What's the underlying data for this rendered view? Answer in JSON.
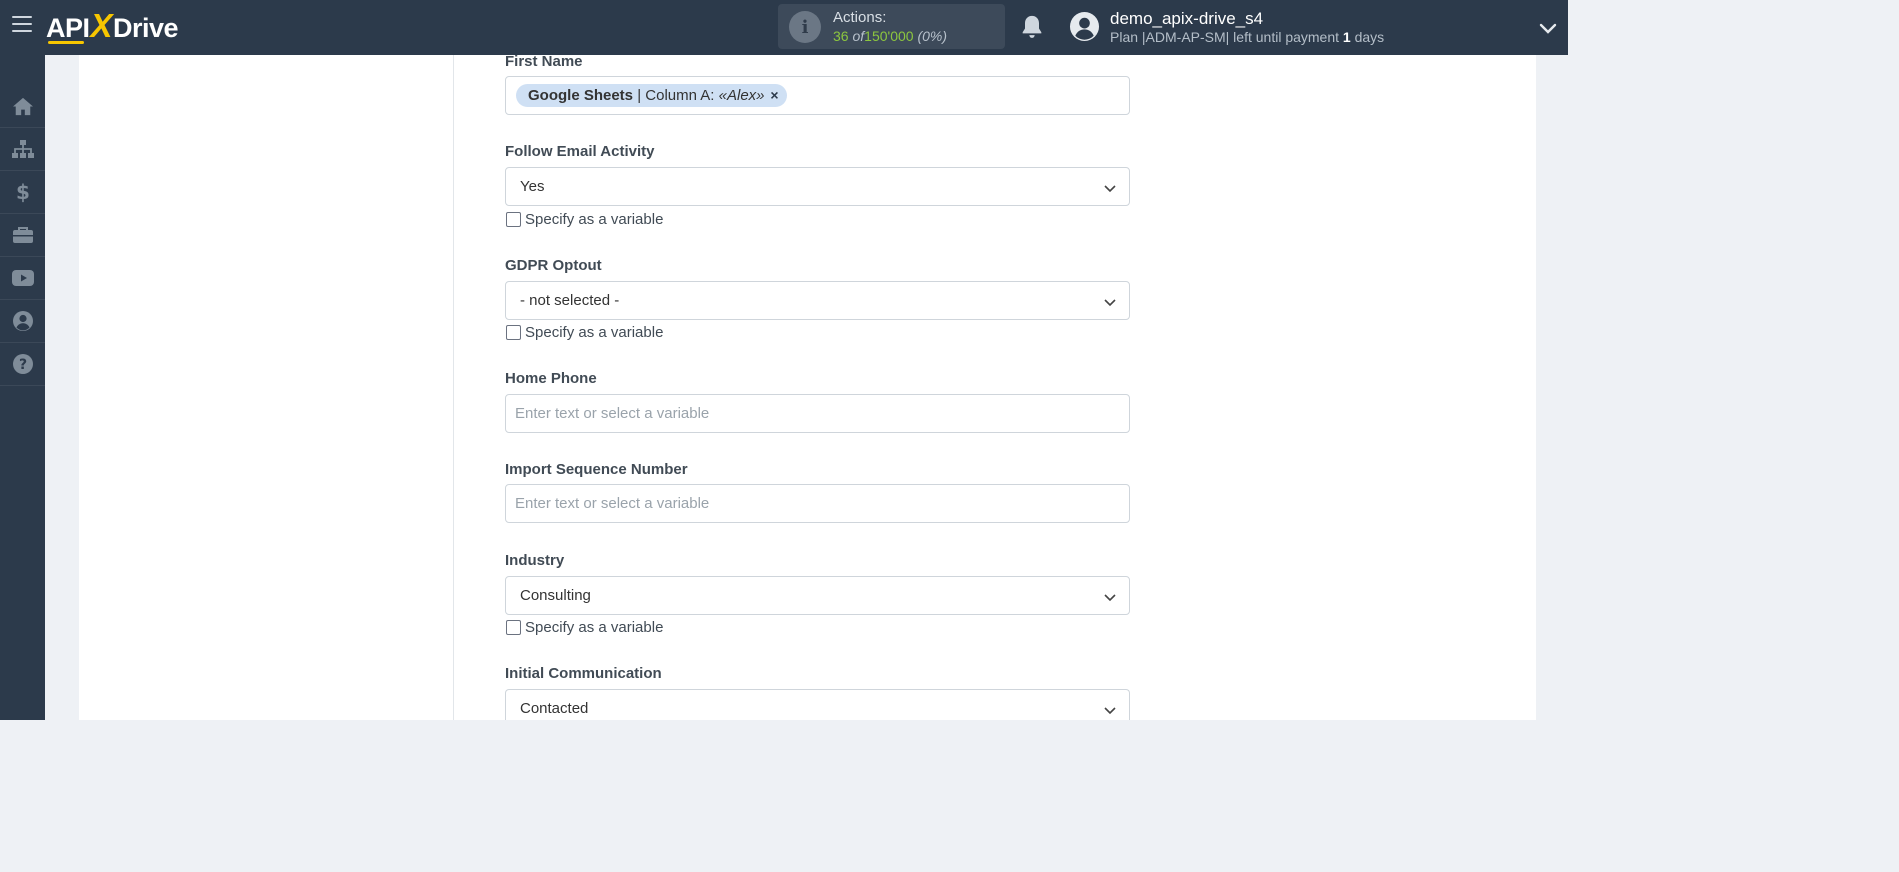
{
  "app": {
    "logo_prefix": "API",
    "logo_x": "X",
    "logo_suffix": "Drive"
  },
  "header": {
    "actions_label": "Actions:",
    "actions_used": "36",
    "actions_of": "of",
    "actions_total": "150'000",
    "actions_percent": "(0%)",
    "user_name": "demo_apix-drive_s4",
    "plan_text": "Plan |ADM-AP-SM| left until payment",
    "plan_days_number": "1",
    "plan_days_word": "days"
  },
  "sidebar": {
    "items": [
      {
        "icon": "home-icon"
      },
      {
        "icon": "sitemap-icon"
      },
      {
        "icon": "dollar-icon"
      },
      {
        "icon": "briefcase-icon"
      },
      {
        "icon": "youtube-icon"
      },
      {
        "icon": "user-circle-icon"
      },
      {
        "icon": "question-circle-icon"
      }
    ]
  },
  "form": {
    "variable_checkbox_label": "Specify as a variable",
    "fields": {
      "first_name": {
        "label": "First Name",
        "tag_source": "Google Sheets",
        "tag_sep": " | ",
        "tag_column": "Column A: ",
        "tag_value": "«Alex»",
        "tag_remove": "×"
      },
      "follow_email_activity": {
        "label": "Follow Email Activity",
        "value": "Yes"
      },
      "gdpr_optout": {
        "label": "GDPR Optout",
        "value": "- not selected -"
      },
      "home_phone": {
        "label": "Home Phone",
        "placeholder": "Enter text or select a variable"
      },
      "import_sequence_number": {
        "label": "Import Sequence Number",
        "placeholder": "Enter text or select a variable"
      },
      "industry": {
        "label": "Industry",
        "value": "Consulting"
      },
      "initial_communication": {
        "label": "Initial Communication",
        "value": "Contacted"
      }
    }
  },
  "colors": {
    "topbar": "#2c3a4b",
    "accent_yellow": "#f7c600",
    "actions_green": "#8cc63f",
    "tag_bg": "#cfe0f4"
  }
}
